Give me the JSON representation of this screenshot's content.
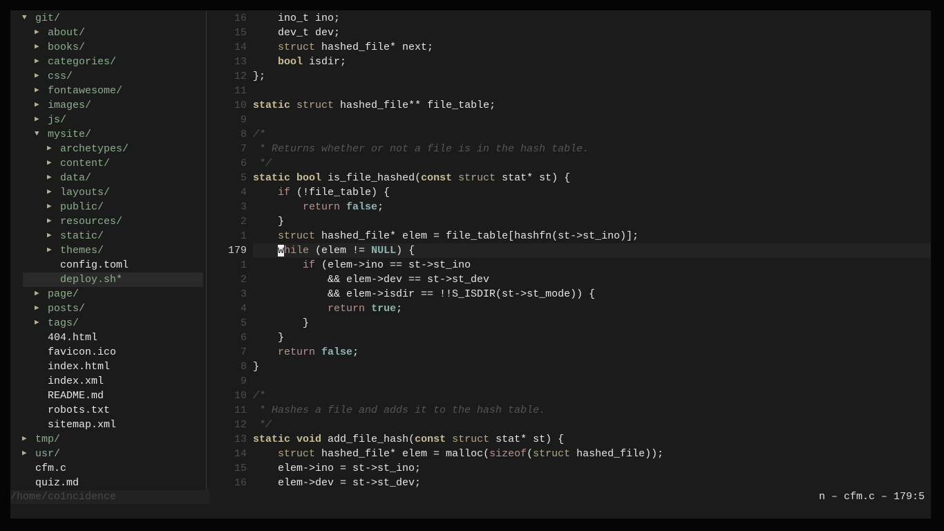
{
  "tree": [
    {
      "depth": 0,
      "arrow": "▼",
      "name": "git/",
      "kind": "dir"
    },
    {
      "depth": 1,
      "arrow": "▶",
      "name": "about/",
      "kind": "dir"
    },
    {
      "depth": 1,
      "arrow": "▶",
      "name": "books/",
      "kind": "dir"
    },
    {
      "depth": 1,
      "arrow": "▶",
      "name": "categories/",
      "kind": "dir"
    },
    {
      "depth": 1,
      "arrow": "▶",
      "name": "css/",
      "kind": "dir"
    },
    {
      "depth": 1,
      "arrow": "▶",
      "name": "fontawesome/",
      "kind": "dir"
    },
    {
      "depth": 1,
      "arrow": "▶",
      "name": "images/",
      "kind": "dir"
    },
    {
      "depth": 1,
      "arrow": "▶",
      "name": "js/",
      "kind": "dir"
    },
    {
      "depth": 1,
      "arrow": "▼",
      "name": "mysite/",
      "kind": "dir"
    },
    {
      "depth": 2,
      "arrow": "▶",
      "name": "archetypes/",
      "kind": "dir"
    },
    {
      "depth": 2,
      "arrow": "▶",
      "name": "content/",
      "kind": "dir"
    },
    {
      "depth": 2,
      "arrow": "▶",
      "name": "data/",
      "kind": "dir"
    },
    {
      "depth": 2,
      "arrow": "▶",
      "name": "layouts/",
      "kind": "dir"
    },
    {
      "depth": 2,
      "arrow": "▶",
      "name": "public/",
      "kind": "dir"
    },
    {
      "depth": 2,
      "arrow": "▶",
      "name": "resources/",
      "kind": "dir"
    },
    {
      "depth": 2,
      "arrow": "▶",
      "name": "static/",
      "kind": "dir"
    },
    {
      "depth": 2,
      "arrow": "▶",
      "name": "themes/",
      "kind": "dir"
    },
    {
      "depth": 2,
      "arrow": "",
      "name": "config.toml",
      "kind": "file"
    },
    {
      "depth": 2,
      "arrow": "",
      "name": "deploy.sh*",
      "kind": "exec",
      "selected": true
    },
    {
      "depth": 1,
      "arrow": "▶",
      "name": "page/",
      "kind": "dir"
    },
    {
      "depth": 1,
      "arrow": "▶",
      "name": "posts/",
      "kind": "dir"
    },
    {
      "depth": 1,
      "arrow": "▶",
      "name": "tags/",
      "kind": "dir"
    },
    {
      "depth": 1,
      "arrow": "",
      "name": "404.html",
      "kind": "file"
    },
    {
      "depth": 1,
      "arrow": "",
      "name": "favicon.ico",
      "kind": "file"
    },
    {
      "depth": 1,
      "arrow": "",
      "name": "index.html",
      "kind": "file"
    },
    {
      "depth": 1,
      "arrow": "",
      "name": "index.xml",
      "kind": "file"
    },
    {
      "depth": 1,
      "arrow": "",
      "name": "README.md",
      "kind": "file"
    },
    {
      "depth": 1,
      "arrow": "",
      "name": "robots.txt",
      "kind": "file"
    },
    {
      "depth": 1,
      "arrow": "",
      "name": "sitemap.xml",
      "kind": "file"
    },
    {
      "depth": 0,
      "arrow": "▶",
      "name": "tmp/",
      "kind": "dir"
    },
    {
      "depth": 0,
      "arrow": "▶",
      "name": "usr/",
      "kind": "dir"
    },
    {
      "depth": 0,
      "arrow": "",
      "name": "cfm.c",
      "kind": "file"
    },
    {
      "depth": 0,
      "arrow": "",
      "name": "quiz.md",
      "kind": "file"
    }
  ],
  "path": "/home/co1ncidence",
  "status": "n – cfm.c – 179:5",
  "code": [
    {
      "num": "16",
      "t": [
        [
          "",
          "    ino_t ino;"
        ]
      ]
    },
    {
      "num": "15",
      "t": [
        [
          "",
          "    dev_t dev;"
        ]
      ]
    },
    {
      "num": "14",
      "t": [
        [
          "",
          "    "
        ],
        [
          "ty",
          "struct"
        ],
        [
          "",
          " hashed_file* next;"
        ]
      ]
    },
    {
      "num": "13",
      "t": [
        [
          "",
          "    "
        ],
        [
          "kw",
          "bool"
        ],
        [
          "",
          " isdir;"
        ]
      ]
    },
    {
      "num": "12",
      "t": [
        [
          "",
          "};"
        ]
      ]
    },
    {
      "num": "11",
      "t": []
    },
    {
      "num": "10",
      "t": [
        [
          "kw",
          "static"
        ],
        [
          "",
          " "
        ],
        [
          "ty",
          "struct"
        ],
        [
          "",
          " hashed_file** file_table;"
        ]
      ]
    },
    {
      "num": "9",
      "t": []
    },
    {
      "num": "8",
      "t": [
        [
          "cm",
          "/*"
        ]
      ]
    },
    {
      "num": "7",
      "t": [
        [
          "cm",
          " * Returns whether or not a file is in the hash table."
        ]
      ]
    },
    {
      "num": "6",
      "t": [
        [
          "cm",
          " */"
        ]
      ]
    },
    {
      "num": "5",
      "t": [
        [
          "kw",
          "static"
        ],
        [
          "",
          " "
        ],
        [
          "kw",
          "bool"
        ],
        [
          "",
          " is_file_hashed("
        ],
        [
          "kw",
          "const"
        ],
        [
          "",
          " "
        ],
        [
          "ty",
          "struct"
        ],
        [
          "",
          " stat* st) {"
        ]
      ]
    },
    {
      "num": "4",
      "t": [
        [
          "",
          "    "
        ],
        [
          "ct",
          "if"
        ],
        [
          "",
          " (!file_table) {"
        ]
      ]
    },
    {
      "num": "3",
      "t": [
        [
          "",
          "        "
        ],
        [
          "ct",
          "return"
        ],
        [
          "",
          " "
        ],
        [
          "bl",
          "false"
        ],
        [
          "",
          ";"
        ]
      ]
    },
    {
      "num": "2",
      "t": [
        [
          "",
          "    }"
        ]
      ]
    },
    {
      "num": "1",
      "t": [
        [
          "",
          "    "
        ],
        [
          "ty",
          "struct"
        ],
        [
          "",
          " hashed_file* elem = file_table[hashfn(st->st_ino)];"
        ]
      ]
    },
    {
      "num": "179",
      "current": true,
      "t": [
        [
          "",
          "    "
        ],
        [
          "cursor",
          "w"
        ],
        [
          "ct",
          "hile"
        ],
        [
          "",
          " (elem != "
        ],
        [
          "bl",
          "NULL"
        ],
        [
          "",
          ") {"
        ]
      ]
    },
    {
      "num": "1",
      "t": [
        [
          "",
          "        "
        ],
        [
          "ct",
          "if"
        ],
        [
          "",
          " (elem->ino == st->st_ino"
        ]
      ]
    },
    {
      "num": "2",
      "t": [
        [
          "",
          "            && elem->dev == st->st_dev"
        ]
      ]
    },
    {
      "num": "3",
      "t": [
        [
          "",
          "            && elem->isdir == !!S_ISDIR(st->st_mode)) {"
        ]
      ]
    },
    {
      "num": "4",
      "t": [
        [
          "",
          "            "
        ],
        [
          "ct",
          "return"
        ],
        [
          "",
          " "
        ],
        [
          "bl",
          "true"
        ],
        [
          "",
          ";"
        ]
      ]
    },
    {
      "num": "5",
      "t": [
        [
          "",
          "        }"
        ]
      ]
    },
    {
      "num": "6",
      "t": [
        [
          "",
          "    }"
        ]
      ]
    },
    {
      "num": "7",
      "t": [
        [
          "",
          "    "
        ],
        [
          "ct",
          "return"
        ],
        [
          "",
          " "
        ],
        [
          "bl",
          "false"
        ],
        [
          "",
          ";"
        ]
      ]
    },
    {
      "num": "8",
      "t": [
        [
          "",
          "}"
        ]
      ]
    },
    {
      "num": "9",
      "t": []
    },
    {
      "num": "10",
      "t": [
        [
          "cm",
          "/*"
        ]
      ]
    },
    {
      "num": "11",
      "t": [
        [
          "cm",
          " * Hashes a file and adds it to the hash table."
        ]
      ]
    },
    {
      "num": "12",
      "t": [
        [
          "cm",
          " */"
        ]
      ]
    },
    {
      "num": "13",
      "t": [
        [
          "kw",
          "static"
        ],
        [
          "",
          " "
        ],
        [
          "kw",
          "void"
        ],
        [
          "",
          " add_file_hash("
        ],
        [
          "kw",
          "const"
        ],
        [
          "",
          " "
        ],
        [
          "ty",
          "struct"
        ],
        [
          "",
          " stat* st) {"
        ]
      ]
    },
    {
      "num": "14",
      "t": [
        [
          "",
          "    "
        ],
        [
          "ty",
          "struct"
        ],
        [
          "",
          " hashed_file* elem = malloc("
        ],
        [
          "fn",
          "sizeof"
        ],
        [
          "",
          "("
        ],
        [
          "ty",
          "struct"
        ],
        [
          "",
          " hashed_file));"
        ]
      ]
    },
    {
      "num": "15",
      "t": [
        [
          "",
          "    elem->ino = st->st_ino;"
        ]
      ]
    },
    {
      "num": "16",
      "t": [
        [
          "",
          "    elem->dev = st->st_dev;"
        ]
      ]
    }
  ]
}
